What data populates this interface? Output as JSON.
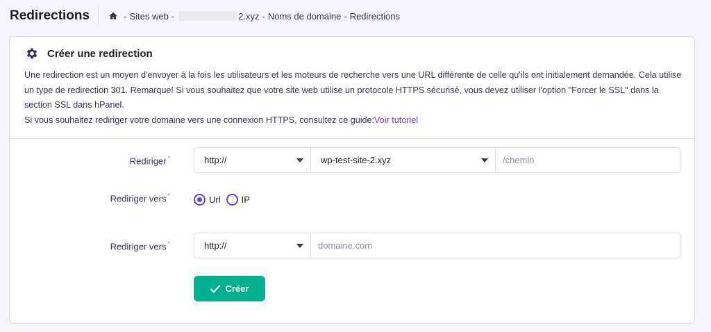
{
  "header": {
    "title": "Redirections",
    "breadcrumb": {
      "sites": "Sites web",
      "domain_suffix": "2.xyz",
      "domains": "Noms de domaine",
      "current": "Redirections"
    }
  },
  "card": {
    "title": "Créer une redirection",
    "description_1": "Une redirection est un moyen d'envoyer à la fois les utilisateurs et les moteurs de recherche vers une URL différente de celle qu'ils ont initialement demandée. Cela utilise un type de redirection 301. Remarque! Si vous souhaitez que votre site web utilise un protocole HTTPS sécurisé, vous devez utiliser l'option \"Forcer le SSL\" dans la section SSL dans hPanel.",
    "description_2": "Si vous souhaitez rediriger votre domaine vers une connexion HTTPS, consultez ce guide:",
    "tutorial_link": "Voir tutoriel"
  },
  "form": {
    "redirect_label": "Rediriger",
    "redirect_protocol": "http://",
    "redirect_domain": "wp-test-site-2.xyz",
    "redirect_path_placeholder": "/chemin",
    "redirect_to_type_label": "Rediriger vers",
    "option_url": "Url",
    "option_ip": "IP",
    "selected_option": "Url",
    "redirect_to_label": "Rediriger vers",
    "target_protocol": "http://",
    "target_domain_placeholder": "domaine.com",
    "submit_label": "Créer"
  },
  "colors": {
    "accent": "#673de6",
    "success": "#00b090",
    "required": "#fc5185"
  }
}
